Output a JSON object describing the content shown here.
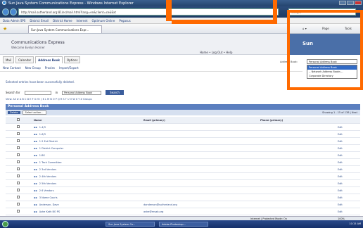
{
  "window": {
    "title": "Sun Java System Communications Express - Windows Internet Explorer"
  },
  "browser": {
    "address": "http://mail.sutherland.org:81/ec/mail.html?lang=en&client=ce&Ext",
    "search_placeholder": "Google",
    "links": [
      "Data Admin SPS",
      "District Email",
      "District Home",
      "Internet",
      "Optimum Online",
      "Pegasus"
    ],
    "tab_title": "Sun Java System Communications Expr...",
    "cmd": {
      "page": "Page",
      "tools": "Tools"
    }
  },
  "app": {
    "title": "Communications Express",
    "subtitle": "Welcome Evelyn Horner",
    "links": "Home  • Log Out  • Help",
    "logo": "Sun",
    "tabs": [
      "Mail",
      "Calendar",
      "Address Book",
      "Options"
    ],
    "active_tab": "Address Book",
    "toolbar": [
      "New Contact",
      "New Group",
      "Proxies",
      "Import/Export"
    ],
    "select_label": "Address Book:",
    "select_value": "Personal Address Book",
    "select_options": [
      "Personal Address Book",
      "-- Network Address Books --",
      "Corporate Directory"
    ],
    "success_msg": "Selected entries have been successfully deleted.",
    "search": {
      "label": "Search for",
      "in_label": "in",
      "book": "Personal Address Book",
      "go": "Search"
    },
    "alphabet": "View:  All  #  A  B  C  D  E  F  G  H  I  J  K  L  M  N  O  P  Q  R  S  T  U  V  W  X  Y  Z  Groups",
    "panel_title": "Personal Address Book",
    "actions": {
      "delete": "Delete",
      "select": "Select action...",
      "paging": "Showing 1 - 15 of 138  |  Next"
    },
    "columns": {
      "name": "Name",
      "email": "Email (primary)",
      "phone": "Phone (primary)"
    },
    "rows": [
      {
        "name": "1-4/3",
        "email": "",
        "edit": "Edit"
      },
      {
        "name": "1-6/3",
        "email": "",
        "edit": "Edit"
      },
      {
        "name": "1-2 Ext District",
        "email": "",
        "edit": "Edit"
      },
      {
        "name": "1 District Computer",
        "email": "",
        "edit": "Edit"
      },
      {
        "name": "1-BS",
        "email": "",
        "edit": "Edit"
      },
      {
        "name": "1 Tech Committee",
        "email": "",
        "edit": "Edit"
      },
      {
        "name": "2 3rd Vendors",
        "email": "",
        "edit": "Edit"
      },
      {
        "name": "2 4th Vendors",
        "email": "",
        "edit": "Edit"
      },
      {
        "name": "2 5th Vendors",
        "email": "",
        "edit": "Edit"
      },
      {
        "name": "2 6 Vendors",
        "email": "",
        "edit": "Edit"
      },
      {
        "name": "3 Name Couris",
        "email": "",
        "edit": "Edit"
      },
      {
        "name": "Anderson, Dave",
        "email": "danderson@sutherland.org",
        "edit": "Edit"
      },
      {
        "name": "Ashe Kath BO PS",
        "email": "ashe@msab.org",
        "edit": "Edit"
      }
    ]
  },
  "status": {
    "zone": "Internet | Protected Mode: On",
    "zoom": "100%"
  },
  "taskbar": {
    "items": [
      "Start",
      "Sun Java System Co...",
      "Adobe Photoshop..."
    ],
    "clock": "10:15 AM"
  },
  "annotation_color": "#ff6a00"
}
